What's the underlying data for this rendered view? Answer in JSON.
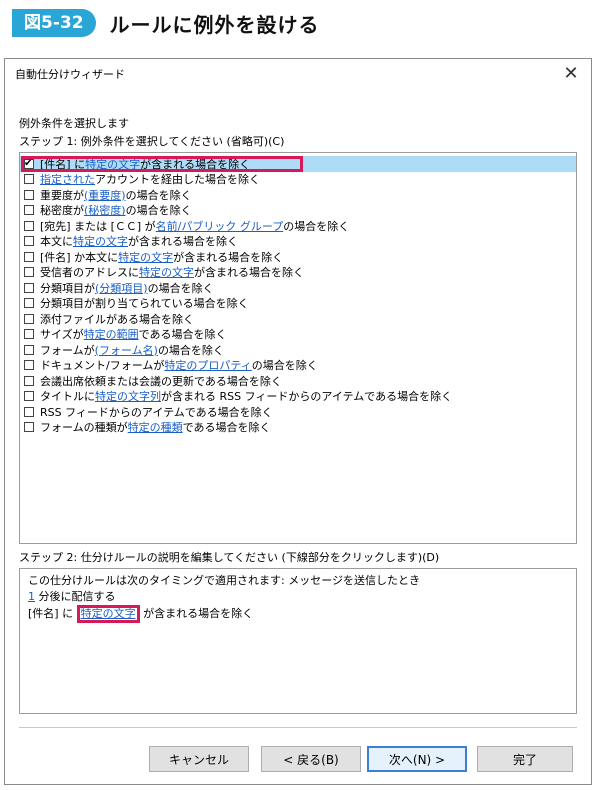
{
  "figure": {
    "badge": "図5-32",
    "title": "ルールに例外を設ける"
  },
  "dialog": {
    "title": "自動仕分けウィザード",
    "close_glyph": "✕",
    "heading": "例外条件を選択します",
    "step1": "ステップ 1: 例外条件を選択してください (省略可)(C)",
    "conditions": [
      {
        "checked": true,
        "parts": [
          [
            "t",
            "[件名] に "
          ],
          [
            "l",
            "特定の文字"
          ],
          [
            "t",
            " が含まれる場合を除く"
          ]
        ]
      },
      {
        "checked": false,
        "parts": [
          [
            "l",
            "指定された"
          ],
          [
            "t",
            " アカウントを経由した場合を除く"
          ]
        ]
      },
      {
        "checked": false,
        "parts": [
          [
            "t",
            "重要度が "
          ],
          [
            "l",
            "(重要度)"
          ],
          [
            "t",
            " の場合を除く"
          ]
        ]
      },
      {
        "checked": false,
        "parts": [
          [
            "t",
            "秘密度が "
          ],
          [
            "l",
            "(秘密度)"
          ],
          [
            "t",
            " の場合を除く"
          ]
        ]
      },
      {
        "checked": false,
        "parts": [
          [
            "t",
            "[宛先] または [ＣＣ] が "
          ],
          [
            "l",
            "名前/パブリック グループ"
          ],
          [
            "t",
            " の場合を除く"
          ]
        ]
      },
      {
        "checked": false,
        "parts": [
          [
            "t",
            "本文に "
          ],
          [
            "l",
            "特定の文字"
          ],
          [
            "t",
            " が含まれる場合を除く"
          ]
        ]
      },
      {
        "checked": false,
        "parts": [
          [
            "t",
            "[件名] か本文に "
          ],
          [
            "l",
            "特定の文字"
          ],
          [
            "t",
            " が含まれる場合を除く"
          ]
        ]
      },
      {
        "checked": false,
        "parts": [
          [
            "t",
            "受信者のアドレスに "
          ],
          [
            "l",
            "特定の文字"
          ],
          [
            "t",
            " が含まれる場合を除く"
          ]
        ]
      },
      {
        "checked": false,
        "parts": [
          [
            "t",
            "分類項目が "
          ],
          [
            "l",
            "(分類項目)"
          ],
          [
            "t",
            " の場合を除く"
          ]
        ]
      },
      {
        "checked": false,
        "parts": [
          [
            "t",
            "分類項目が割り当てられている場合を除く"
          ]
        ]
      },
      {
        "checked": false,
        "parts": [
          [
            "t",
            "添付ファイルがある場合を除く"
          ]
        ]
      },
      {
        "checked": false,
        "parts": [
          [
            "t",
            "サイズが "
          ],
          [
            "l",
            "特定の範囲"
          ],
          [
            "t",
            " である場合を除く"
          ]
        ]
      },
      {
        "checked": false,
        "parts": [
          [
            "t",
            "フォームが "
          ],
          [
            "l",
            "(フォーム名)"
          ],
          [
            "t",
            " の場合を除く"
          ]
        ]
      },
      {
        "checked": false,
        "parts": [
          [
            "t",
            "ドキュメント/フォームが "
          ],
          [
            "l",
            "特定のプロパティ"
          ],
          [
            "t",
            " の場合を除く"
          ]
        ]
      },
      {
        "checked": false,
        "parts": [
          [
            "t",
            "会議出席依頼または会議の更新である場合を除く"
          ]
        ]
      },
      {
        "checked": false,
        "parts": [
          [
            "t",
            "タイトルに "
          ],
          [
            "l",
            "特定の文字列"
          ],
          [
            "t",
            " が含まれる RSS フィードからのアイテムである場合を除く"
          ]
        ]
      },
      {
        "checked": false,
        "parts": [
          [
            "t",
            "RSS フィードからのアイテムである場合を除く"
          ]
        ]
      },
      {
        "checked": false,
        "parts": [
          [
            "t",
            "フォームの種類が "
          ],
          [
            "l",
            "特定の種類"
          ],
          [
            "t",
            " である場合を除く"
          ]
        ]
      }
    ],
    "step2": "ステップ 2: 仕分けルールの説明を編集してください (下線部分をクリックします)(D)",
    "description": {
      "line1": "この仕分けルールは次のタイミングで適用されます: メッセージを送信したとき",
      "line2_link": "1",
      "line2_text": " 分後に配信する",
      "line3_pre": "[件名] に ",
      "line3_link": "特定の文字",
      "line3_post": " が含まれる場合を除く"
    },
    "buttons": {
      "cancel": "キャンセル",
      "back": "< 戻る(B)",
      "next": "次へ(N) >",
      "finish": "完了"
    }
  }
}
